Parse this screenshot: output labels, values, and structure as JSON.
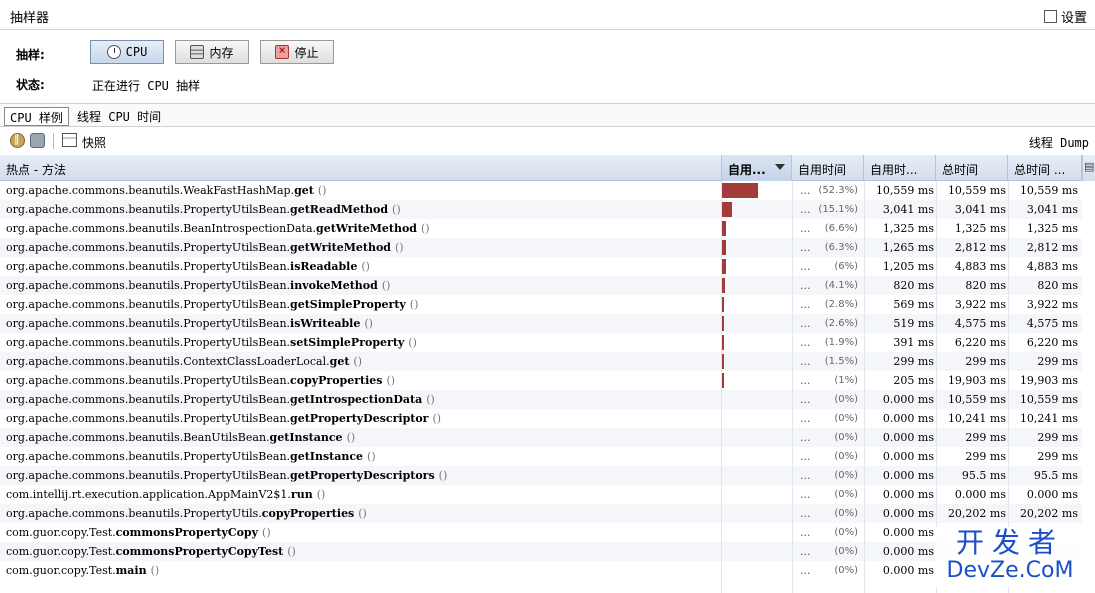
{
  "window": {
    "title": "抽样器",
    "settings_label": "设置"
  },
  "controls": {
    "sample_label": "抽样:",
    "cpu_button": "CPU",
    "memory_button": "内存",
    "stop_button": "停止",
    "status_label": "状态:",
    "status_value": "正在进行 CPU 抽样"
  },
  "tabs": [
    {
      "label": "CPU 样例",
      "active": true
    },
    {
      "label": "线程 CPU 时间",
      "active": false
    }
  ],
  "toolbar": {
    "snapshot_label": "快照",
    "thread_dump_label": "线程 Dump"
  },
  "table": {
    "columns": [
      "热点 - 方法",
      "自用...",
      "自用时间",
      "自用时...",
      "总时间",
      "总时间 ..."
    ],
    "dots": "...",
    "rows": [
      {
        "pkg": "org.apache.commons.beanutils.WeakFastHashMap.",
        "method": "get",
        "bar": 0.523,
        "pct": "(52.3%)",
        "self": "10,559 ms",
        "total": "10,559 ms",
        "total2": "10,559 ms"
      },
      {
        "pkg": "org.apache.commons.beanutils.PropertyUtilsBean.",
        "method": "getReadMethod",
        "bar": 0.151,
        "pct": "(15.1%)",
        "self": "3,041 ms",
        "total": "3,041 ms",
        "total2": "3,041 ms"
      },
      {
        "pkg": "org.apache.commons.beanutils.BeanIntrospectionData.",
        "method": "getWriteMethod",
        "bar": 0.066,
        "pct": "(6.6%)",
        "self": "1,325 ms",
        "total": "1,325 ms",
        "total2": "1,325 ms"
      },
      {
        "pkg": "org.apache.commons.beanutils.PropertyUtilsBean.",
        "method": "getWriteMethod",
        "bar": 0.063,
        "pct": "(6.3%)",
        "self": "1,265 ms",
        "total": "2,812 ms",
        "total2": "2,812 ms"
      },
      {
        "pkg": "org.apache.commons.beanutils.PropertyUtilsBean.",
        "method": "isReadable",
        "bar": 0.06,
        "pct": "(6%)",
        "self": "1,205 ms",
        "total": "4,883 ms",
        "total2": "4,883 ms"
      },
      {
        "pkg": "org.apache.commons.beanutils.PropertyUtilsBean.",
        "method": "invokeMethod",
        "bar": 0.041,
        "pct": "(4.1%)",
        "self": "820 ms",
        "total": "820 ms",
        "total2": "820 ms"
      },
      {
        "pkg": "org.apache.commons.beanutils.PropertyUtilsBean.",
        "method": "getSimpleProperty",
        "bar": 0.028,
        "pct": "(2.8%)",
        "self": "569 ms",
        "total": "3,922 ms",
        "total2": "3,922 ms"
      },
      {
        "pkg": "org.apache.commons.beanutils.PropertyUtilsBean.",
        "method": "isWriteable",
        "bar": 0.026,
        "pct": "(2.6%)",
        "self": "519 ms",
        "total": "4,575 ms",
        "total2": "4,575 ms"
      },
      {
        "pkg": "org.apache.commons.beanutils.PropertyUtilsBean.",
        "method": "setSimpleProperty",
        "bar": 0.019,
        "pct": "(1.9%)",
        "self": "391 ms",
        "total": "6,220 ms",
        "total2": "6,220 ms"
      },
      {
        "pkg": "org.apache.commons.beanutils.ContextClassLoaderLocal.",
        "method": "get",
        "bar": 0.015,
        "pct": "(1.5%)",
        "self": "299 ms",
        "total": "299 ms",
        "total2": "299 ms"
      },
      {
        "pkg": "org.apache.commons.beanutils.PropertyUtilsBean.",
        "method": "copyProperties",
        "bar": 0.01,
        "pct": "(1%)",
        "self": "205 ms",
        "total": "19,903 ms",
        "total2": "19,903 ms"
      },
      {
        "pkg": "org.apache.commons.beanutils.PropertyUtilsBean.",
        "method": "getIntrospectionData",
        "bar": 0,
        "pct": "(0%)",
        "self": "0.000 ms",
        "total": "10,559 ms",
        "total2": "10,559 ms"
      },
      {
        "pkg": "org.apache.commons.beanutils.PropertyUtilsBean.",
        "method": "getPropertyDescriptor",
        "bar": 0,
        "pct": "(0%)",
        "self": "0.000 ms",
        "total": "10,241 ms",
        "total2": "10,241 ms"
      },
      {
        "pkg": "org.apache.commons.beanutils.BeanUtilsBean.",
        "method": "getInstance",
        "bar": 0,
        "pct": "(0%)",
        "self": "0.000 ms",
        "total": "299 ms",
        "total2": "299 ms"
      },
      {
        "pkg": "org.apache.commons.beanutils.PropertyUtilsBean.",
        "method": "getInstance",
        "bar": 0,
        "pct": "(0%)",
        "self": "0.000 ms",
        "total": "299 ms",
        "total2": "299 ms"
      },
      {
        "pkg": "org.apache.commons.beanutils.PropertyUtilsBean.",
        "method": "getPropertyDescriptors",
        "bar": 0,
        "pct": "(0%)",
        "self": "0.000 ms",
        "total": "95.5 ms",
        "total2": "95.5 ms"
      },
      {
        "pkg": "com.intellij.rt.execution.application.AppMainV2$1.",
        "method": "run",
        "bar": 0,
        "pct": "(0%)",
        "self": "0.000 ms",
        "total": "0.000 ms",
        "total2": "0.000 ms"
      },
      {
        "pkg": "org.apache.commons.beanutils.PropertyUtils.",
        "method": "copyProperties",
        "bar": 0,
        "pct": "(0%)",
        "self": "0.000 ms",
        "total": "20,202 ms",
        "total2": "20,202 ms"
      },
      {
        "pkg": "com.guor.copy.Test.",
        "method": "commonsPropertyCopy",
        "bar": 0,
        "pct": "(0%)",
        "self": "0.000 ms",
        "total": "",
        "total2": ""
      },
      {
        "pkg": "com.guor.copy.Test.",
        "method": "commonsPropertyCopyTest",
        "bar": 0,
        "pct": "(0%)",
        "self": "0.000 ms",
        "total": "",
        "total2": ""
      },
      {
        "pkg": "com.guor.copy.Test.",
        "method": "main",
        "bar": 0,
        "pct": "(0%)",
        "self": "0.000 ms",
        "total": "",
        "total2": ""
      }
    ]
  },
  "watermark": {
    "line1": "开发者",
    "line2": "DevZe.CoM"
  },
  "colors": {
    "bar": "#a33b3b",
    "header": "#d3deec",
    "watermark": "#1a4fc8"
  }
}
